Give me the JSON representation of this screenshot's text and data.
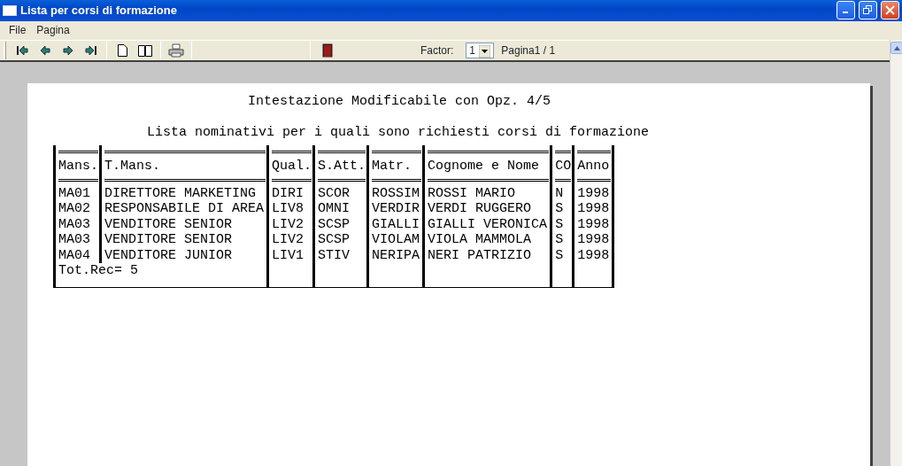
{
  "window": {
    "title": "Lista per corsi di formazione"
  },
  "menu": [
    "File",
    "Pagina"
  ],
  "toolbar": {
    "buttons": [
      {
        "kind": "first"
      },
      {
        "kind": "prev"
      },
      {
        "kind": "next"
      },
      {
        "kind": "last"
      },
      {
        "kind": "page"
      },
      {
        "kind": "book"
      },
      {
        "kind": "print"
      },
      {
        "kind": "exit"
      }
    ],
    "factor_label": "Factor:",
    "factor": "1",
    "page_info": "Pagina1 / 1"
  },
  "report": {
    "heading": "Intestazione Modificabile con Opz. 4/5",
    "subtitle": "Lista nominativi per i quali sono richiesti corsi di formazione",
    "columns": [
      "Mans.",
      "T.Mans.",
      "Qual.",
      "S.Att.",
      "Matr.",
      "Cognome e Nome",
      "CO",
      "Anno"
    ],
    "rows": [
      [
        "MA01",
        "DIRETTORE MARKETING",
        "DIRI",
        "SCOR",
        "ROSSIM",
        "ROSSI MARIO",
        "N",
        "1998"
      ],
      [
        "MA02",
        "RESPONSABILE DI AREA",
        "LIV8",
        "OMNI",
        "VERDIR",
        "VERDI RUGGERO",
        "S",
        "1998"
      ],
      [
        "MA03",
        "VENDITORE SENIOR",
        "LIV2",
        "SCSP",
        "GIALLI",
        "GIALLI VERONICA",
        "S",
        "1998"
      ],
      [
        "MA03",
        "VENDITORE SENIOR",
        "LIV2",
        "SCSP",
        "VIOLAM",
        "VIOLA MAMMOLA",
        "S",
        "1998"
      ],
      [
        "MA04",
        "VENDITORE JUNIOR",
        "LIV1",
        "STIV",
        "NERIPA",
        "NERI PATRIZIO",
        "S",
        "1998"
      ]
    ],
    "footer": "Tot.Rec= 5"
  }
}
